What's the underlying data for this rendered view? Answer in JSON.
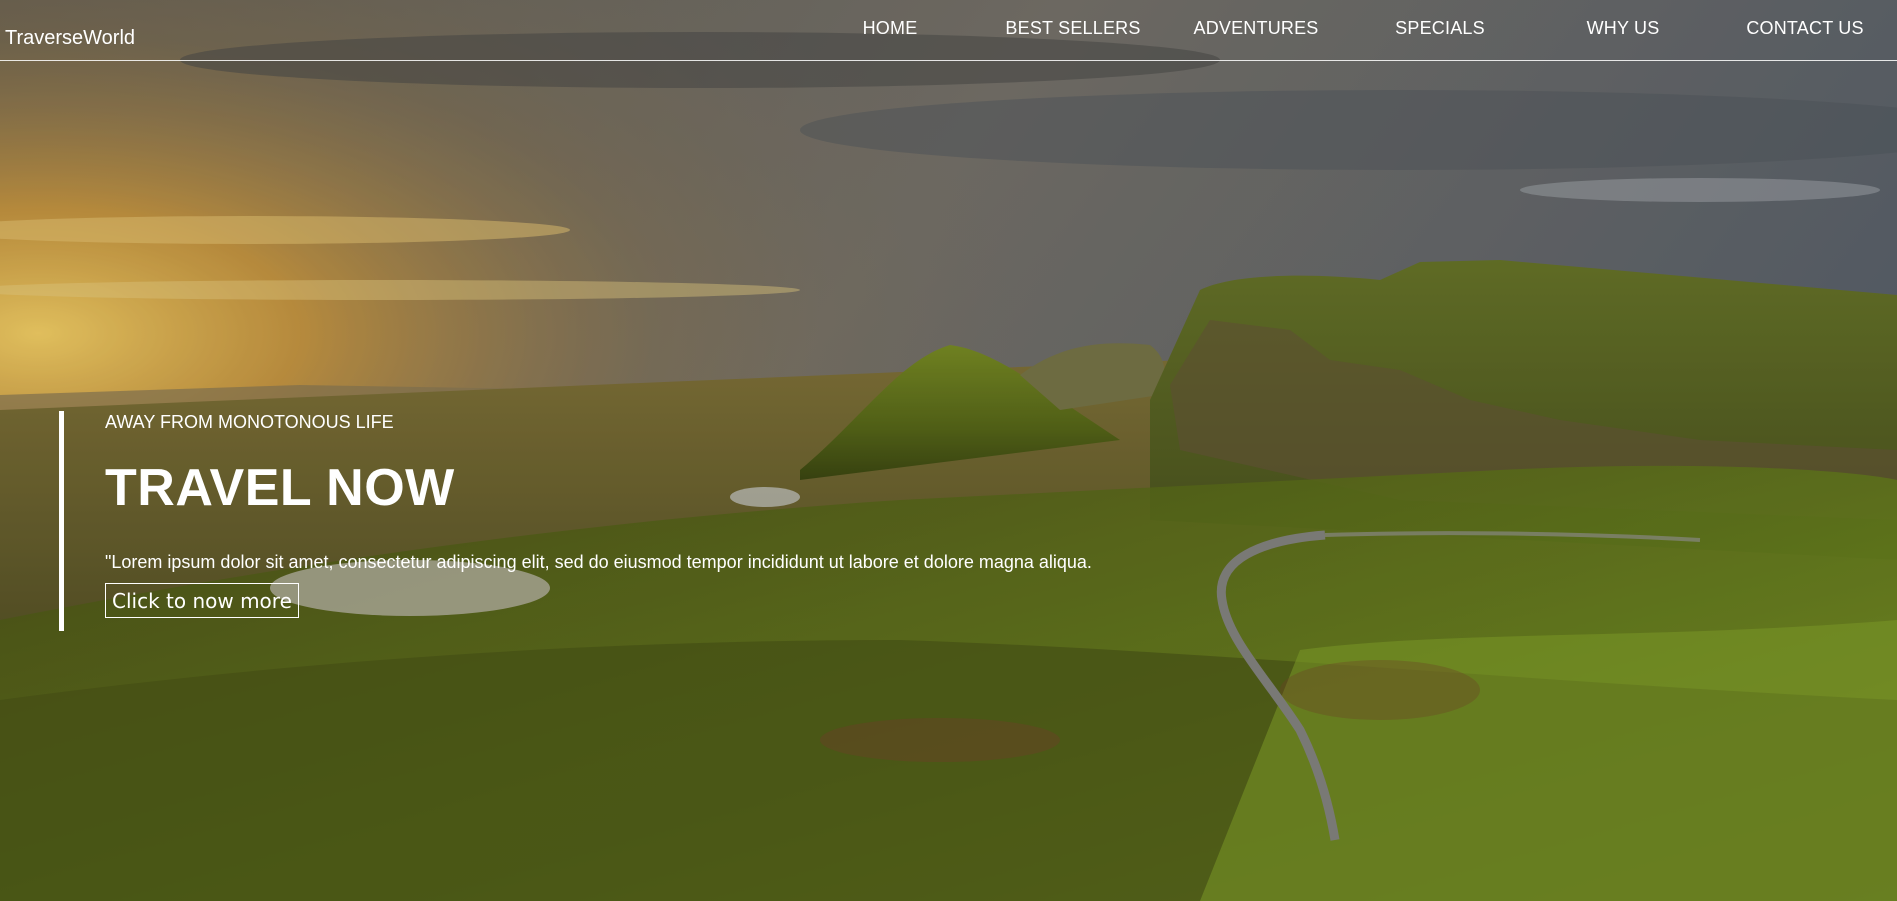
{
  "brand": "TraverseWorld",
  "nav": {
    "items": [
      {
        "label": "HOME"
      },
      {
        "label": "BEST SELLERS"
      },
      {
        "label": "ADVENTURES"
      },
      {
        "label": "SPECIALS"
      },
      {
        "label": "WHY US"
      },
      {
        "label": "CONTACT US"
      }
    ]
  },
  "hero": {
    "kicker": "AWAY FROM MONOTONOUS LIFE",
    "headline": "TRAVEL NOW",
    "description": "\"Lorem ipsum dolor sit amet, consectetur adipiscing elit, sed do eiusmod tempor incididunt ut labore et dolore magna aliqua.",
    "cta_label": "Click to now more"
  },
  "colors": {
    "text": "#ffffff",
    "sky_dark": "#5a5f66",
    "sunset": "#f0c050",
    "grass": "#6f8a20"
  }
}
